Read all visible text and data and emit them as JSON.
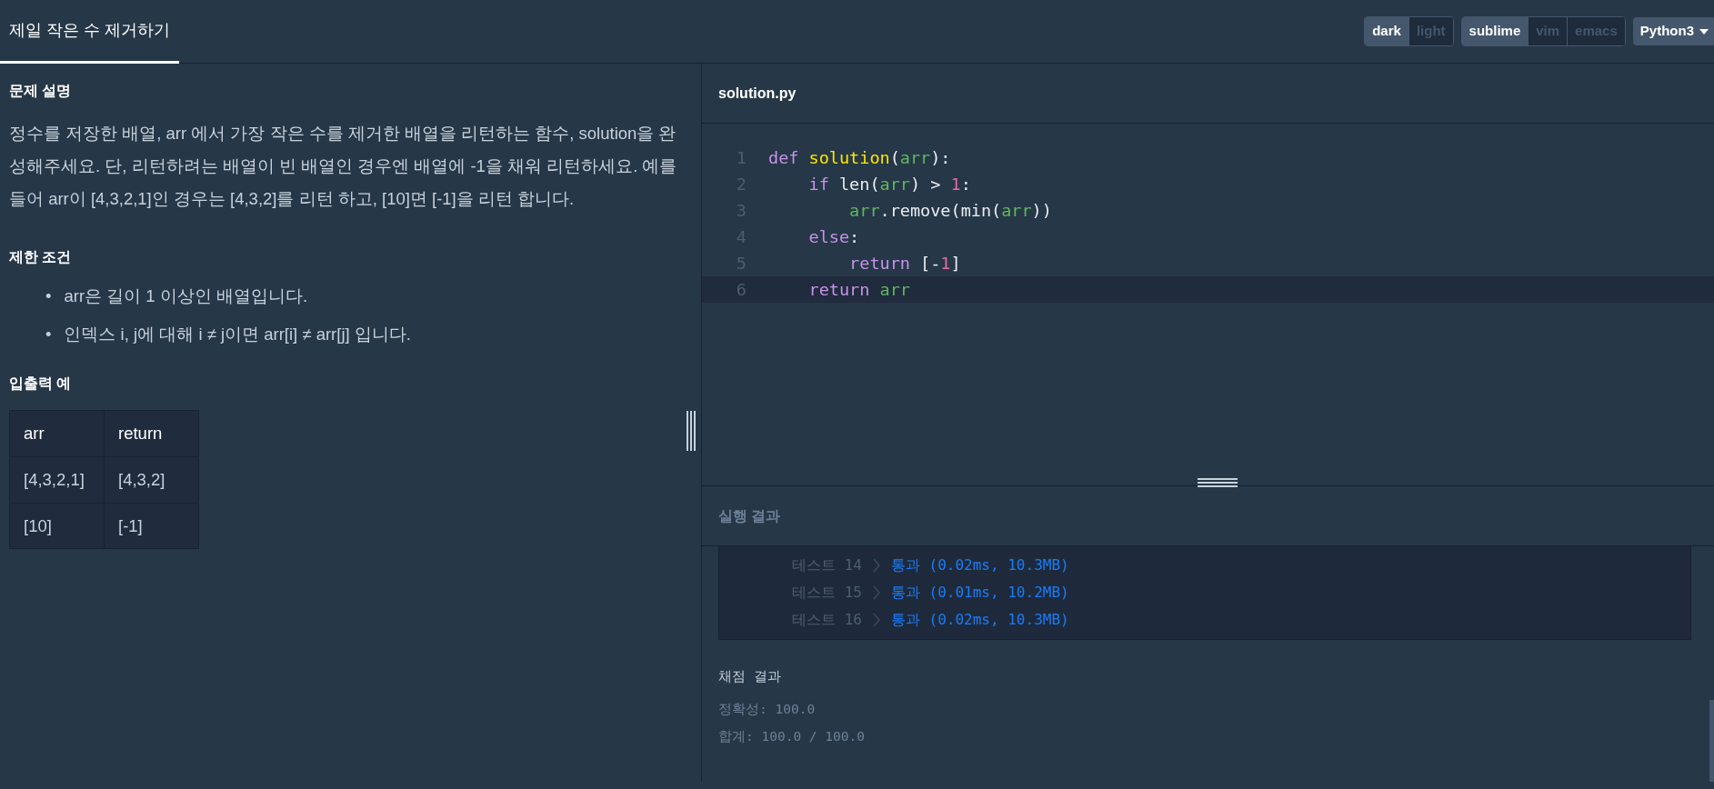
{
  "tabs": [
    {
      "label": "제일 작은 수 제거하기",
      "selected": true
    }
  ],
  "theme_toggle": [
    {
      "label": "dark",
      "selected": true
    },
    {
      "label": "light",
      "selected": false
    }
  ],
  "keymap_toggle": [
    {
      "label": "sublime",
      "selected": true
    },
    {
      "label": "vim",
      "selected": false
    },
    {
      "label": "emacs",
      "selected": false
    }
  ],
  "language_dropdown": {
    "label": "Python3"
  },
  "problem": {
    "title": "문제 설명",
    "description": "정수를 저장한 배열, arr 에서 가장 작은 수를 제거한 배열을 리턴하는 함수, solution을 완성해주세요. 단, 리턴하려는 배열이 빈 배열인 경우엔 배열에 -1을 채워 리턴하세요. 예를들어 arr이 [4,3,2,1]인 경우는 [4,3,2]를 리턴 하고, [10]면 [-1]을 리턴 합니다.",
    "constraints_title": "제한 조건",
    "constraints": [
      {
        "bullet": "•",
        "text": "arr은 길이 1 이상인 배열입니다."
      },
      {
        "bullet": "•",
        "text": "인덱스 i, j에 대해 i ≠ j이면 arr[i] ≠ arr[j] 입니다."
      }
    ],
    "examples_title": "입출력 예",
    "table": {
      "columns": [
        "arr",
        "return"
      ],
      "rows": [
        [
          "[4,3,2,1]",
          "[4,3,2]"
        ],
        [
          "[10]",
          "[-1]"
        ]
      ]
    }
  },
  "editor": {
    "filename": "solution.py",
    "lines": [
      {
        "number": "1",
        "highlighted": false,
        "tokens": [
          {
            "kind": "keyword",
            "text": "def "
          },
          {
            "kind": "function",
            "text": "solution"
          },
          {
            "kind": "plain",
            "text": "("
          },
          {
            "kind": "variable",
            "text": "arr"
          },
          {
            "kind": "plain",
            "text": "):"
          }
        ]
      },
      {
        "number": "2",
        "highlighted": false,
        "tokens": [
          {
            "kind": "keyword",
            "text": "    if"
          },
          {
            "kind": "plain",
            "text": " len("
          },
          {
            "kind": "variable",
            "text": "arr"
          },
          {
            "kind": "plain",
            "text": ") > "
          },
          {
            "kind": "number",
            "text": "1"
          },
          {
            "kind": "plain",
            "text": ":"
          }
        ]
      },
      {
        "number": "3",
        "highlighted": false,
        "tokens": [
          {
            "kind": "variable",
            "text": "        arr"
          },
          {
            "kind": "plain",
            "text": ".remove(min("
          },
          {
            "kind": "variable",
            "text": "arr"
          },
          {
            "kind": "plain",
            "text": "))"
          }
        ]
      },
      {
        "number": "4",
        "highlighted": false,
        "tokens": [
          {
            "kind": "keyword",
            "text": "    else"
          },
          {
            "kind": "plain",
            "text": ":"
          }
        ]
      },
      {
        "number": "5",
        "highlighted": false,
        "tokens": [
          {
            "kind": "keyword",
            "text": "        return"
          },
          {
            "kind": "plain",
            "text": " [-"
          },
          {
            "kind": "number",
            "text": "1"
          },
          {
            "kind": "plain",
            "text": "]"
          }
        ]
      },
      {
        "number": "6",
        "highlighted": true,
        "tokens": [
          {
            "kind": "keyword",
            "text": "    return "
          },
          {
            "kind": "variable",
            "text": "arr"
          }
        ]
      }
    ]
  },
  "results": {
    "title": "실행 결과",
    "tests": [
      {
        "label": "테스트 14",
        "result": "통과 (0.02ms, 10.3MB)"
      },
      {
        "label": "테스트 15",
        "result": "통과 (0.01ms, 10.2MB)"
      },
      {
        "label": "테스트 16",
        "result": "통과 (0.02ms, 10.3MB)"
      }
    ],
    "score_title": "채점 결과",
    "score_lines": [
      "정확성: 100.0",
      "합계: 100.0 / 100.0"
    ]
  }
}
